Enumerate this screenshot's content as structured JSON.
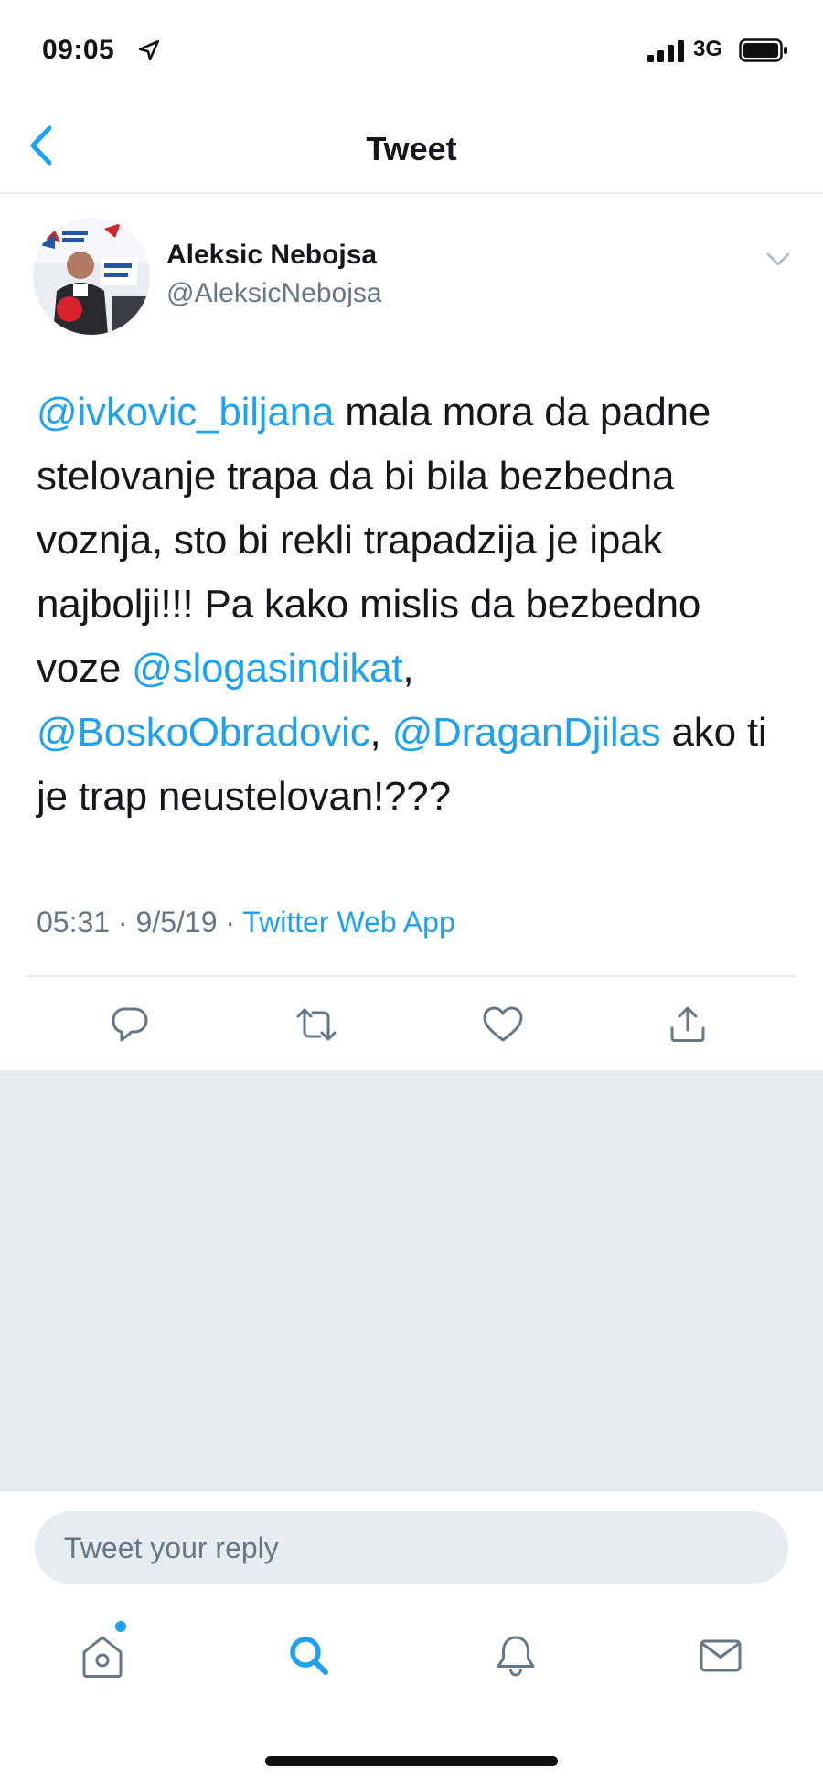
{
  "status_bar": {
    "time": "09:05",
    "network": "3G"
  },
  "nav": {
    "title": "Tweet"
  },
  "tweet": {
    "author": {
      "name": "Aleksic Nebojsa",
      "handle": "@AleksicNebojsa"
    },
    "body": {
      "mention_1": "@ivkovic_biljana",
      "text_1": " mala mora da padne stelovanje trapa da bi bila bezbedna voznja, sto bi rekli trapadzija je ipak najbolji!!! Pa kako mislis da bezbedno voze ",
      "mention_2": "@slogasindikat",
      "sep_1": ",",
      "mention_3": "@BoskoObradovic",
      "sep_2": ", ",
      "mention_4": "@DraganDjilas",
      "text_2": " ako ti je trap neustelovan!???"
    },
    "meta": {
      "time": "05:31",
      "dot_1": " · ",
      "date": "9/5/19",
      "dot_2": " · ",
      "source": "Twitter Web App"
    }
  },
  "reply": {
    "placeholder": "Tweet your reply"
  },
  "colors": {
    "accent": "#1da1f2",
    "secondary_text": "#657786",
    "filler": "#e6ecf0"
  },
  "icons": {
    "actions": [
      "reply-icon",
      "retweet-icon",
      "like-icon",
      "share-icon"
    ],
    "tabs": [
      "home-icon",
      "search-icon",
      "notifications-icon",
      "messages-icon"
    ]
  }
}
